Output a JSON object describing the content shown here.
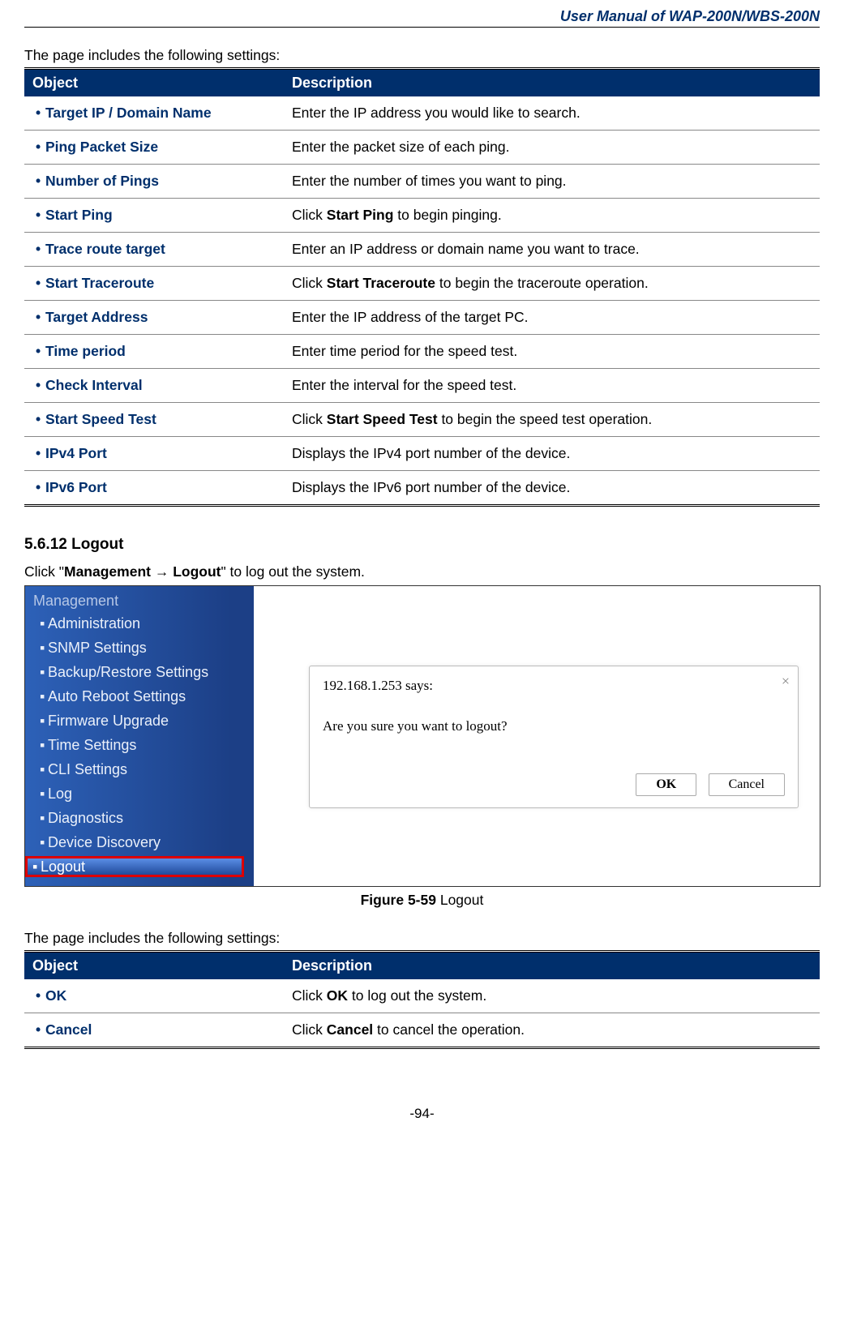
{
  "header": {
    "title": "User Manual of WAP-200N/WBS-200N"
  },
  "intro_text_1": "The page includes the following settings:",
  "table1": {
    "header_object": "Object",
    "header_desc": "Description",
    "rows": [
      {
        "obj": "Target IP / Domain Name",
        "desc_pre": "Enter the IP address you would like to search.",
        "bold": "",
        "desc_post": ""
      },
      {
        "obj": "Ping Packet Size",
        "desc_pre": "Enter the packet size of each ping.",
        "bold": "",
        "desc_post": ""
      },
      {
        "obj": "Number of Pings",
        "desc_pre": "Enter the number of times you want to ping.",
        "bold": "",
        "desc_post": ""
      },
      {
        "obj": "Start Ping",
        "desc_pre": "Click ",
        "bold": "Start Ping",
        "desc_post": " to begin pinging."
      },
      {
        "obj": "Trace route target",
        "desc_pre": "Enter an IP address or domain name you want to trace.",
        "bold": "",
        "desc_post": ""
      },
      {
        "obj": "Start Traceroute",
        "desc_pre": "Click ",
        "bold": "Start Traceroute",
        "desc_post": " to begin the traceroute operation."
      },
      {
        "obj": "Target Address",
        "desc_pre": "Enter the IP address of the target PC.",
        "bold": "",
        "desc_post": ""
      },
      {
        "obj": "Time period",
        "desc_pre": "Enter time period for the speed test.",
        "bold": "",
        "desc_post": ""
      },
      {
        "obj": "Check Interval",
        "desc_pre": "Enter the interval for the speed test.",
        "bold": "",
        "desc_post": ""
      },
      {
        "obj": "Start Speed Test",
        "desc_pre": "Click ",
        "bold": "Start Speed Test",
        "desc_post": " to begin the speed test operation."
      },
      {
        "obj": "IPv4 Port",
        "desc_pre": "Displays the IPv4 port number of the device.",
        "bold": "",
        "desc_post": ""
      },
      {
        "obj": "IPv6 Port",
        "desc_pre": "Displays the IPv6 port number of the device.",
        "bold": "",
        "desc_post": ""
      }
    ]
  },
  "section_heading": "5.6.12 Logout",
  "click_instr": {
    "pre": "Click \"",
    "bold": "Management → Logout",
    "post": "\" to log out the system."
  },
  "figure": {
    "sidebar": {
      "title": "Management",
      "items": [
        "Administration",
        "SNMP Settings",
        "Backup/Restore Settings",
        "Auto Reboot Settings",
        "Firmware Upgrade",
        "Time Settings",
        "CLI Settings",
        "Log",
        "Diagnostics",
        "Device Discovery"
      ],
      "highlighted": "Logout"
    },
    "dialog": {
      "title": "192.168.1.253 says:",
      "message": "Are you sure you want to logout?",
      "ok_label": "OK",
      "cancel_label": "Cancel"
    }
  },
  "figure_caption": {
    "bold": "Figure 5-59",
    "rest": " Logout"
  },
  "intro_text_2": "The page includes the following settings:",
  "table2": {
    "header_object": "Object",
    "header_desc": "Description",
    "rows": [
      {
        "obj": "OK",
        "desc_pre": "Click ",
        "bold": "OK",
        "desc_post": " to log out the system."
      },
      {
        "obj": "Cancel",
        "desc_pre": "Click ",
        "bold": "Cancel",
        "desc_post": " to cancel the operation."
      }
    ]
  },
  "page_number": "-94-"
}
